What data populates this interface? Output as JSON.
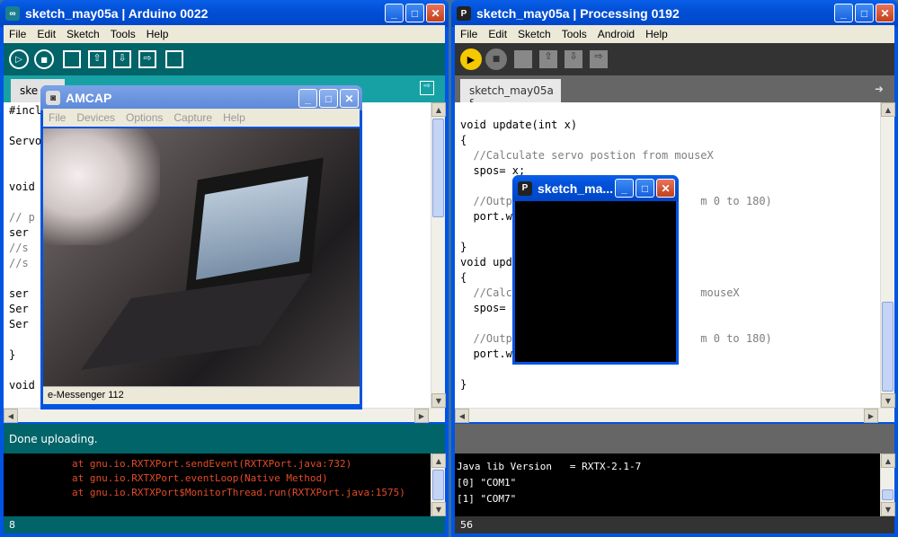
{
  "arduino": {
    "title": "sketch_may05a | Arduino 0022",
    "menu": [
      "File",
      "Edit",
      "Sketch",
      "Tools",
      "Help"
    ],
    "tab": "ske",
    "code": [
      "#incl",
      "",
      "Servo",
      "",
      "",
      "void",
      "",
      "// p",
      "ser",
      "//s",
      "//s",
      "",
      "ser",
      "Ser",
      "Ser",
      "",
      "}",
      "",
      "void"
    ],
    "status": "Done uploading.",
    "console": [
      "at gnu.io.RXTXPort.sendEvent(RXTXPort.java:732)",
      "at gnu.io.RXTXPort.eventLoop(Native Method)",
      "at gnu.io.RXTXPort$MonitorThread.run(RXTXPort.java:1575)"
    ],
    "line_number": "8"
  },
  "amcap": {
    "title": "AMCAP",
    "menu": [
      "File",
      "Devices",
      "Options",
      "Capture",
      "Help"
    ],
    "status": "e-Messenger 112"
  },
  "processing": {
    "title": "sketch_may05a | Processing 0192",
    "menu": [
      "File",
      "Edit",
      "Sketch",
      "Tools",
      "Android",
      "Help"
    ],
    "tab": "sketch_may05a §",
    "code": [
      "void update(int x)",
      "{",
      "  //Calculate servo postion from mouseX",
      "  spos= x;",
      "",
      "  //Outpu                            m 0 to 180)",
      "  port.wr",
      "",
      "}",
      "void upda",
      "{",
      "  //Calcu                            mouseX",
      "  spos= x",
      "",
      "  //Outpu                            m 0 to 180)",
      "  port.wr",
      "",
      "}"
    ],
    "console": [
      "Java lib Version   = RXTX-2.1-7",
      "[0] \"COM1\"",
      "[1] \"COM7\""
    ],
    "line_number": "56"
  },
  "sketch_window": {
    "title": "sketch_ma..."
  }
}
